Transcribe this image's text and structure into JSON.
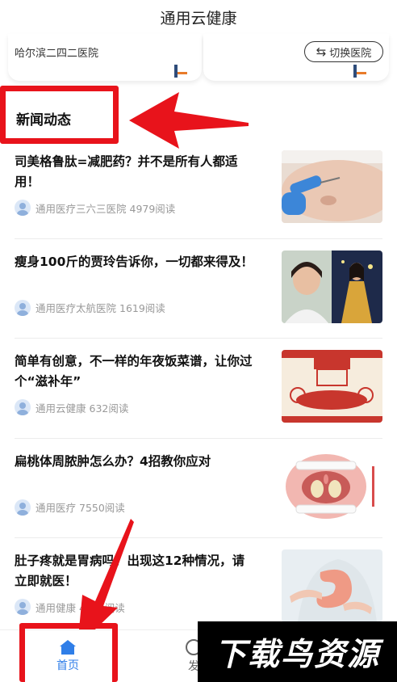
{
  "app": {
    "title": "通用云健康"
  },
  "hospital": {
    "name": "哈尔滨二四二医院",
    "switch_label": "切换医院",
    "switch_icon": "swap-arrows-icon"
  },
  "section": {
    "title": "新闻动态"
  },
  "news": [
    {
      "title": "司美格鲁肽=减肥药？并不是所有人都适用！",
      "source": "通用医疗三六三医院",
      "reads": "4979阅读",
      "thumb": "injection-belly-image"
    },
    {
      "title": "瘦身100斤的贾玲告诉你，一切都来得及！",
      "source": "通用医疗太航医院",
      "reads": "1619阅读",
      "thumb": "before-after-portrait-image"
    },
    {
      "title": "简单有创意，不一样的年夜饭菜谱，让你过个“滋补年”",
      "source": "通用云健康",
      "reads": "632阅读",
      "thumb": "new-year-dinner-illustration"
    },
    {
      "title": "扁桃体周脓肿怎么办？4招教你应对",
      "source": "通用医疗",
      "reads": "7550阅读",
      "thumb": "throat-illustration"
    },
    {
      "title": "肚子疼就是胃病吗？出现这12种情况，请立即就医！",
      "source": "通用健康",
      "reads": "4510阅读",
      "thumb": "stomach-illustration"
    }
  ],
  "tabs": [
    {
      "label": "首页",
      "icon": "home-icon",
      "active": true
    },
    {
      "label": "发",
      "icon": "discover-icon",
      "active": false
    }
  ],
  "watermark": {
    "text": "下载鸟资源"
  },
  "colors": {
    "accent": "#2f7ee8",
    "annotation": "#e8131b"
  }
}
